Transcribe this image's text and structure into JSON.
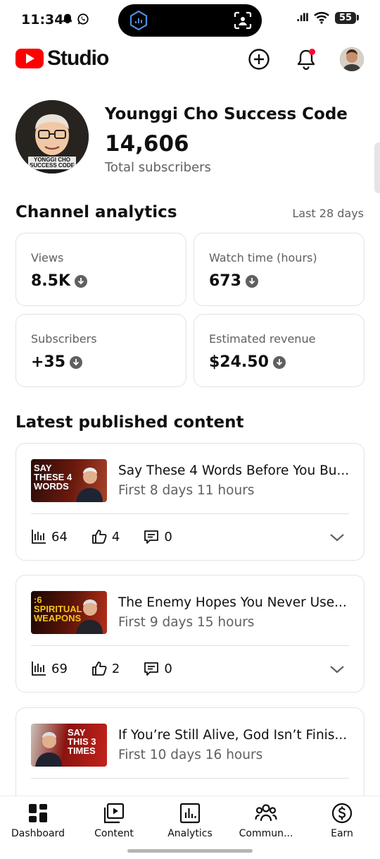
{
  "status_bar": {
    "time": "11:34",
    "battery": "55"
  },
  "header": {
    "app_name": "Studio",
    "brand_color": "#ff0000",
    "icons": [
      "create-icon",
      "notifications-icon",
      "avatar"
    ]
  },
  "channel": {
    "name": "Younggi Cho Success Code",
    "avatar_caption": "YONGGI CHO SUCCESS CODE",
    "subscribers": "14,606",
    "subscribers_label": "Total subscribers"
  },
  "analytics": {
    "title": "Channel analytics",
    "period": "Last 28 days",
    "cards": [
      {
        "label": "Views",
        "value": "8.5K",
        "trend": "down"
      },
      {
        "label": "Watch time (hours)",
        "value": "673",
        "trend": "down"
      },
      {
        "label": "Subscribers",
        "value": "+35",
        "trend": "down"
      },
      {
        "label": "Estimated revenue",
        "value": "$24.50",
        "trend": "down"
      }
    ]
  },
  "latest": {
    "title": "Latest published content",
    "videos": [
      {
        "thumb_text": "Say these 4 words",
        "thumb_accent": "#f5c518",
        "title": "Say These 4 Words Before You Bu...",
        "meta": "First 8 days 11 hours",
        "views": "64",
        "likes": "4",
        "comments": "0"
      },
      {
        "thumb_text": ":6 Spiritual Weapons",
        "thumb_accent": "#f5c518",
        "title": "The Enemy Hopes You Never Use...",
        "meta": "First 9 days 15 hours",
        "views": "69",
        "likes": "2",
        "comments": "0"
      },
      {
        "thumb_text": "Say this 3 times",
        "thumb_accent": "#ffffff",
        "title": "If You’re Still Alive, God Isn’t Finis...",
        "meta": "First 10 days 16 hours",
        "views": "",
        "likes": "",
        "comments": ""
      }
    ]
  },
  "bottom_nav": [
    {
      "label": "Dashboard",
      "icon": "dashboard-icon"
    },
    {
      "label": "Content",
      "icon": "content-icon"
    },
    {
      "label": "Analytics",
      "icon": "analytics-icon"
    },
    {
      "label": "Commun...",
      "icon": "community-icon"
    },
    {
      "label": "Earn",
      "icon": "earn-icon"
    }
  ]
}
